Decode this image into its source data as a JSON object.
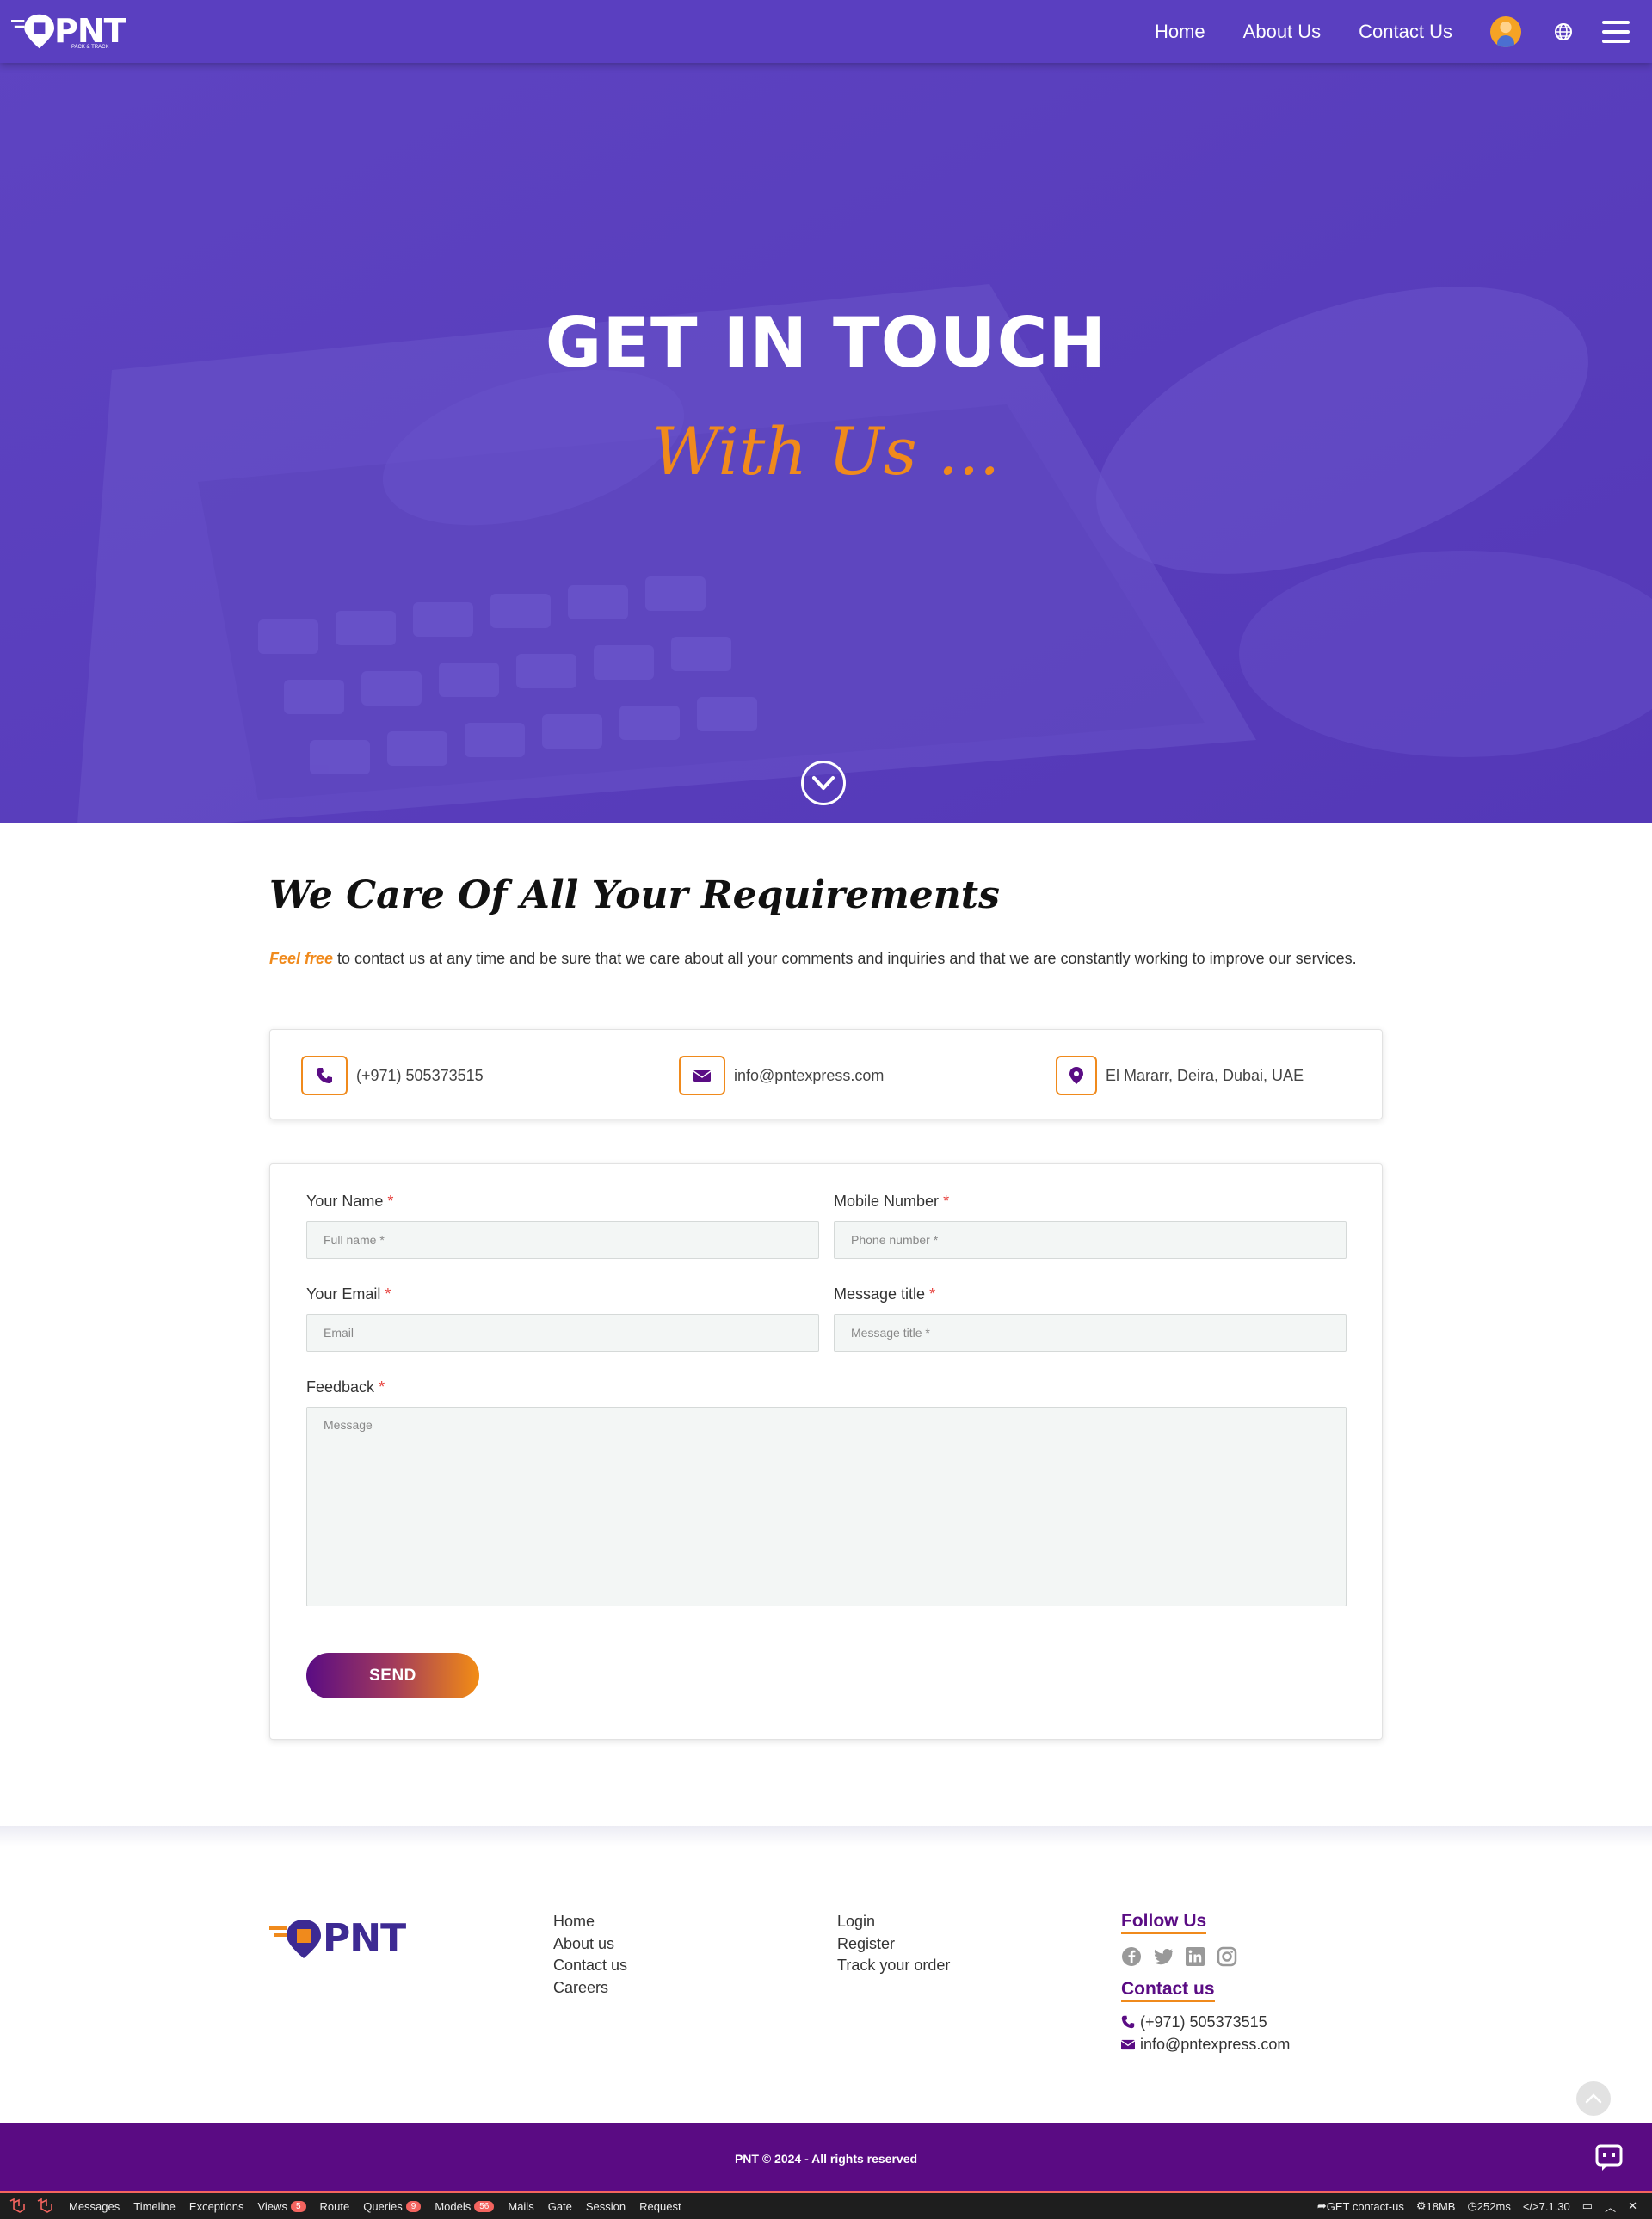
{
  "nav": {
    "logo_text": "PNT",
    "logo_sub": "PACK & TRACK",
    "links": [
      "Home",
      "About Us",
      "Contact Us"
    ]
  },
  "hero": {
    "title": "GET IN TOUCH",
    "subtitle": "With Us ..."
  },
  "care": {
    "title": "We Care Of All Your Requirements",
    "lead": "Feel free",
    "text": " to contact us at any time and be sure that we care about all your comments and inquiries and that we are constantly working to improve our services."
  },
  "info": {
    "phone": "(+971) 505373515",
    "email": "info@pntexpress.com",
    "address": "El Mararr, Deira, Dubai, UAE"
  },
  "form": {
    "name_label": "Your Name",
    "name_placeholder": "Full name *",
    "mobile_label": "Mobile Number",
    "mobile_placeholder": "Phone number *",
    "email_label": "Your Email",
    "email_placeholder": "Email",
    "title_label": "Message title",
    "title_placeholder": "Message title *",
    "feedback_label": "Feedback",
    "feedback_placeholder": "Message",
    "required_mark": "*",
    "send_label": "SEND"
  },
  "footer": {
    "logo_text": "PNT",
    "links_col1": [
      "Home",
      "About us",
      "Contact us",
      "Careers"
    ],
    "links_col2": [
      "Login",
      "Register",
      "Track your order"
    ],
    "follow_title": "Follow Us",
    "contact_title": "Contact us",
    "phone": "(+971) 505373515",
    "email": "info@pntexpress.com",
    "copyright": "PNT © 2024 - All rights reserved"
  },
  "debugbar": {
    "tabs": [
      {
        "label": "Messages"
      },
      {
        "label": "Timeline"
      },
      {
        "label": "Exceptions"
      },
      {
        "label": "Views",
        "badge": "5"
      },
      {
        "label": "Route"
      },
      {
        "label": "Queries",
        "badge": "9"
      },
      {
        "label": "Models",
        "badge": "56"
      },
      {
        "label": "Mails"
      },
      {
        "label": "Gate"
      },
      {
        "label": "Session"
      },
      {
        "label": "Request"
      }
    ],
    "route": "GET contact-us",
    "memory": "18MB",
    "time": "252ms",
    "php": "7.1.30"
  },
  "colors": {
    "primary": "#5a3fc0",
    "accent": "#f08a1c",
    "footer_bar": "#5a0b83"
  }
}
